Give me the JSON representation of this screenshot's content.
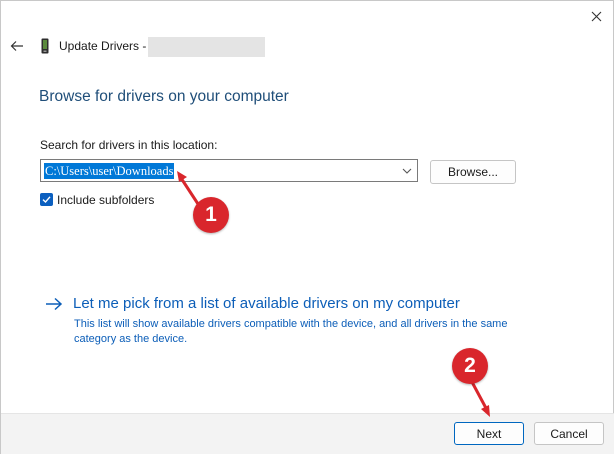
{
  "header": {
    "title": "Update Drivers -",
    "back_icon": "arrow-left-icon",
    "device_icon": "device-icon",
    "close_icon": "close-icon"
  },
  "main": {
    "heading": "Browse for drivers on your computer",
    "search_label": "Search for drivers in this location:",
    "path_value": "C:\\Users\\user\\Downloads",
    "browse_label": "Browse...",
    "include_subfolders_label": "Include subfolders",
    "include_subfolders_checked": true,
    "pick_link_title": "Let me pick from a list of available drivers on my computer",
    "pick_link_description": "This list will show available drivers compatible with the device, and all drivers in the same category as the device."
  },
  "footer": {
    "next_label": "Next",
    "cancel_label": "Cancel"
  },
  "annotations": {
    "callout_1": "1",
    "callout_2": "2",
    "callout_color": "#d9262c"
  },
  "colors": {
    "heading": "#1f4e79",
    "link": "#0c5eb8",
    "selection": "#0078d7",
    "checkbox": "#0b5fbf",
    "primary_border": "#0067c0"
  }
}
